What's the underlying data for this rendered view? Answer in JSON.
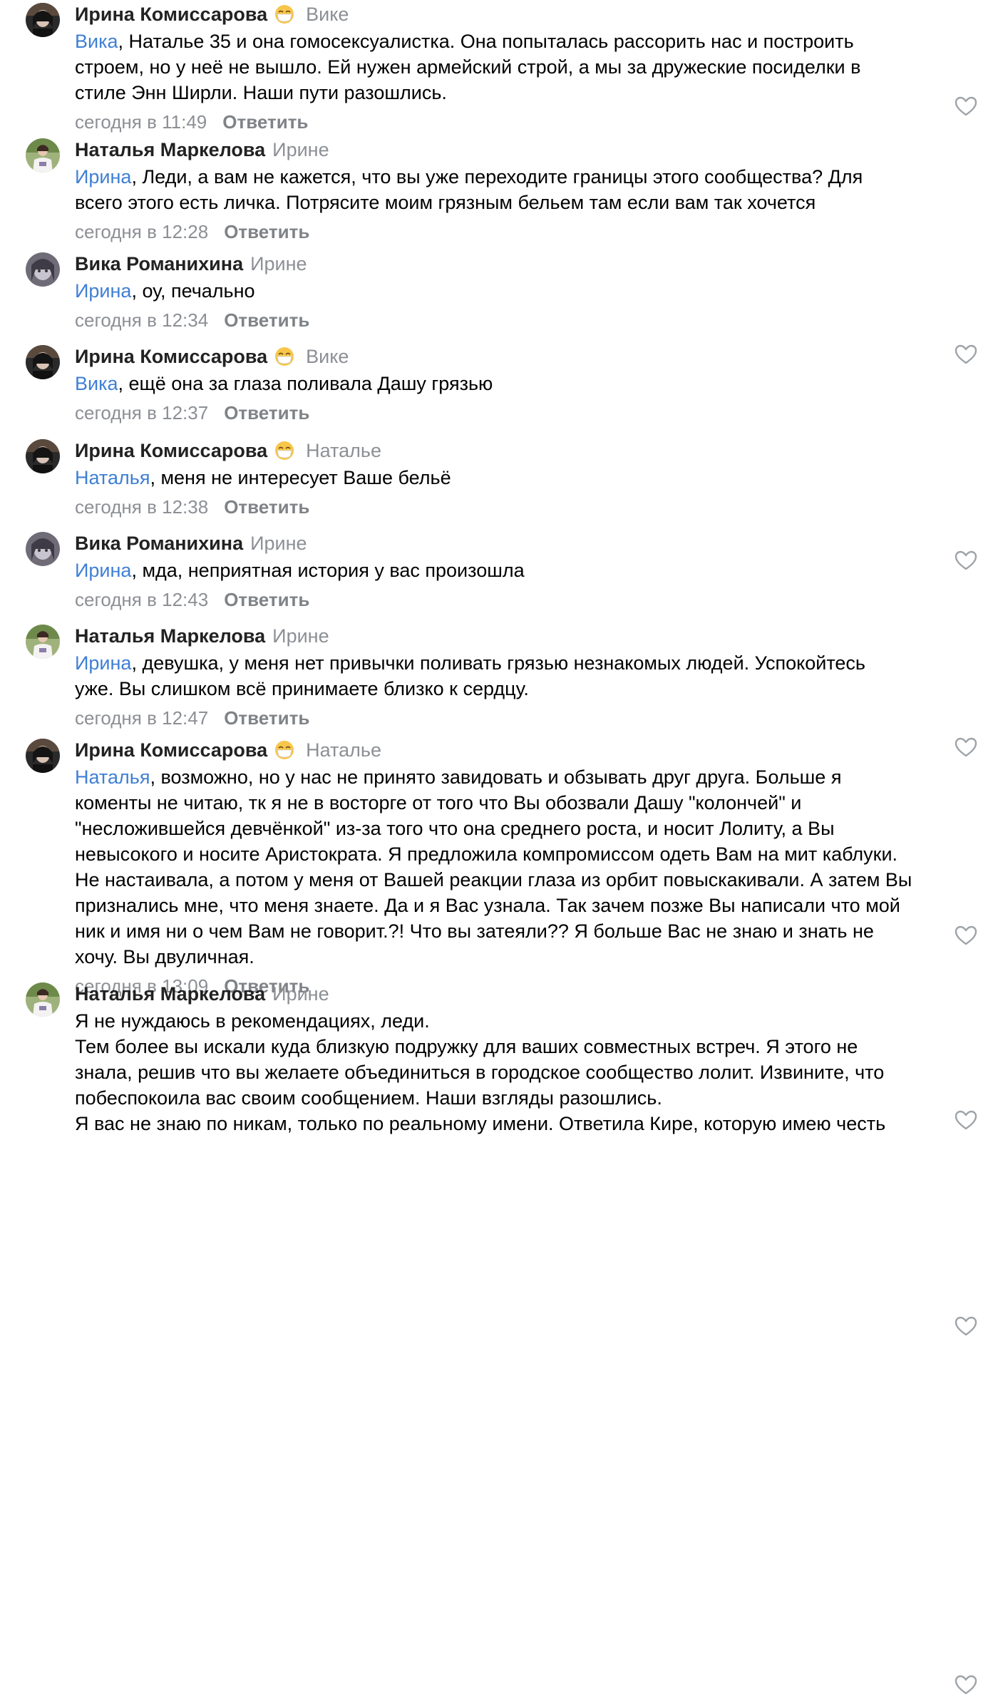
{
  "comments": [
    {
      "author": "Ирина Комиссарова",
      "has_emoji": true,
      "reply_to": "Вике",
      "mention": "Вика",
      "text_lines": [
        ", Наталье 35 и она гомосексуалистка. Она попыталась рассорить нас и построить",
        "строем, но у неё не вышло. Ей нужен армейский строй, а мы за дружеские посиделки в",
        "стиле Энн Ширли. Наши пути разошлись."
      ],
      "time": "сегодня в 11:49",
      "reply_label": "Ответить",
      "avatar": "irina-avatar"
    },
    {
      "author": "Наталья Маркелова",
      "has_emoji": false,
      "reply_to": "Ирине",
      "mention": "Ирина",
      "text_lines": [
        ", Леди, а вам не кажется, что вы уже переходите границы этого сообщества? Для",
        "всего этого есть личка. Потрясите моим грязным бельем там если вам так хочется"
      ],
      "time": "сегодня в 12:28",
      "reply_label": "Ответить",
      "avatar": "natalia-avatar"
    },
    {
      "author": "Вика Романихина",
      "has_emoji": false,
      "reply_to": "Ирине",
      "mention": "Ирина",
      "text_lines": [
        ", оу, печально"
      ],
      "time": "сегодня в 12:34",
      "reply_label": "Ответить",
      "avatar": "vika-avatar"
    },
    {
      "author": "Ирина Комиссарова",
      "has_emoji": true,
      "reply_to": "Вике",
      "mention": "Вика",
      "text_lines": [
        ", ещё она за глаза поливала Дашу грязью"
      ],
      "time": "сегодня в 12:37",
      "reply_label": "Ответить",
      "avatar": "irina-avatar"
    },
    {
      "author": "Ирина Комиссарова",
      "has_emoji": true,
      "reply_to": "Наталье",
      "mention": "Наталья",
      "text_lines": [
        ", меня не интересует Ваше бельё"
      ],
      "time": "сегодня в 12:38",
      "reply_label": "Ответить",
      "avatar": "irina-avatar"
    },
    {
      "author": "Вика Романихина",
      "has_emoji": false,
      "reply_to": "Ирине",
      "mention": "Ирина",
      "text_lines": [
        ", мда, неприятная история у вас произошла"
      ],
      "time": "сегодня в 12:43",
      "reply_label": "Ответить",
      "avatar": "vika-avatar"
    },
    {
      "author": "Наталья Маркелова",
      "has_emoji": false,
      "reply_to": "Ирине",
      "mention": "Ирина",
      "text_lines": [
        ", девушка, у меня нет привычки поливать грязью незнакомых людей. Успокойтесь",
        "уже. Вы слишком всё принимаете близко к сердцу."
      ],
      "time": "сегодня в 12:47",
      "reply_label": "Ответить",
      "avatar": "natalia-avatar"
    },
    {
      "author": "Ирина Комиссарова",
      "has_emoji": true,
      "reply_to": "Наталье",
      "mention": "Наталья",
      "text_lines": [
        ", возможно, но у нас не принято завидовать и обзывать друг друга. Больше я",
        "коменты не читаю, тк я не в восторге от того что Вы обозвали Дашу \"колончей\" и",
        "\"несложившейся девчёнкой\"  из-за того что она среднего роста, и носит Лолиту, а Вы",
        "невысокого и носите Аристократа. Я предложила компромиссом одеть Вам на мит каблуки.",
        "Не настаивала, а потом у меня от Вашей реакции глаза из орбит повыскакивали. А затем Вы",
        "признались мне, что меня знаете. Да и я Вас узнала. Так зачем позже Вы написали что мой",
        "ник и имя ни о чем Вам не говорит.?! Что вы затеяли?? Я больше Вас не знаю и знать не",
        "хочу. Вы двуличная."
      ],
      "time": "сегодня в 13:09",
      "reply_label": "Ответить",
      "avatar": "irina-avatar"
    },
    {
      "author": "Наталья Маркелова",
      "has_emoji": false,
      "reply_to": "Ирине",
      "mention": "",
      "text_lines": [
        "Я не нуждаюсь в рекомендациях, леди.",
        "Тем более вы искали куда близкую подружку для ваших совместных встреч. Я этого не",
        "знала, решив что вы желаете объединиться в городское сообщество лолит.  Извините, что",
        "побеспокоила вас своим сообщением. Наши взгляды разошлись.",
        "Я вас не знаю по никам, только по реальному имени. Ответила Кире, которую имею честь"
      ],
      "time": "",
      "reply_label": "",
      "avatar": "natalia-avatar"
    }
  ]
}
